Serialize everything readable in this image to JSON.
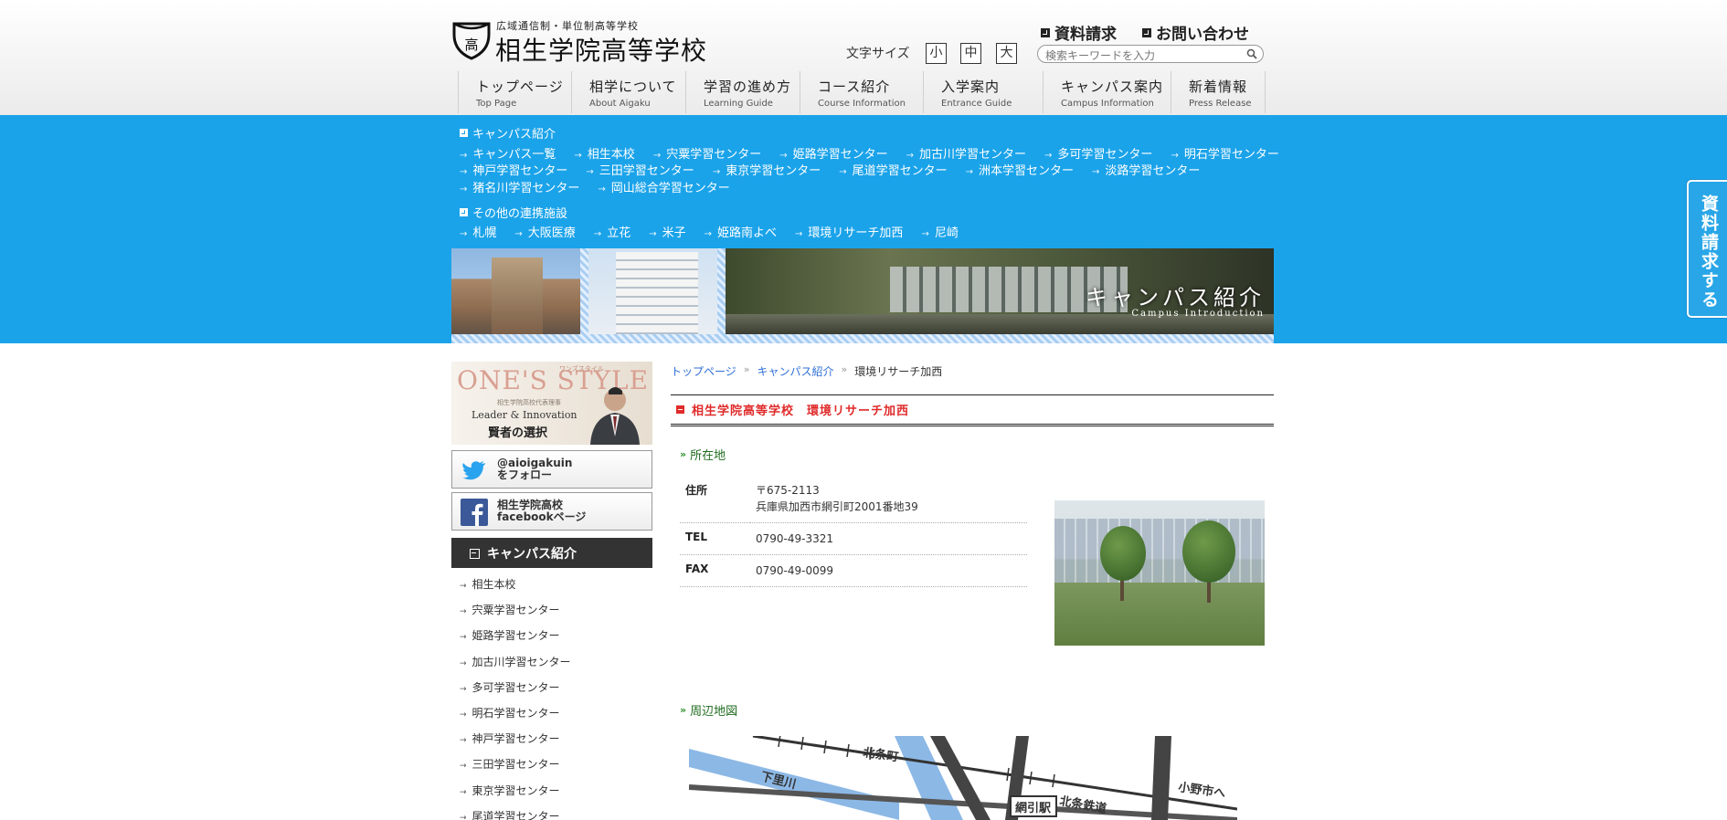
{
  "header": {
    "logo_sub": "広域通信制・単位制高等学校",
    "logo_name": "相生学院高等学校",
    "links": {
      "request": "資料請求",
      "contact": "お問い合わせ"
    },
    "font_size_label": "文字サイズ",
    "font_sizes": [
      "小",
      "中",
      "大"
    ],
    "search_placeholder": "検索キーワードを入力"
  },
  "gnav": [
    {
      "ja": "トップページ",
      "en": "Top Page"
    },
    {
      "ja": "相学について",
      "en": "About Aigaku"
    },
    {
      "ja": "学習の進め方",
      "en": "Learning Guide"
    },
    {
      "ja": "コース紹介",
      "en": "Course Information"
    },
    {
      "ja": "入学案内",
      "en": "Entrance Guide"
    },
    {
      "ja": "キャンパス案内",
      "en": "Campus Information"
    },
    {
      "ja": "新着情報",
      "en": "Press Release"
    }
  ],
  "campus_menu": {
    "title": "キャンパス紹介",
    "row1": [
      "キャンパス一覧",
      "相生本校",
      "宍粟学習センター",
      "姫路学習センター",
      "加古川学習センター",
      "多可学習センター",
      "明石学習センター"
    ],
    "row2": [
      "神戸学習センター",
      "三田学習センター",
      "東京学習センター",
      "尾道学習センター",
      "洲本学習センター",
      "淡路学習センター"
    ],
    "row3": [
      "猪名川学習センター",
      "岡山総合学習センター"
    ]
  },
  "partner_menu": {
    "title": "その他の連携施設",
    "row1": [
      "札幌",
      "大阪医療",
      "立花",
      "米子",
      "姫路南よべ",
      "環境リサーチ加西",
      "尼崎"
    ]
  },
  "banner": {
    "title": "キャンパス紹介",
    "subtitle": "Campus Introduction"
  },
  "side_tab": "資料請求する",
  "sidebar": {
    "ones_style": {
      "title": "ONE'S STYLE",
      "small": "ワンズスタイル",
      "line": "相生学院高校代表理事",
      "tag1": "Leader & Innovation",
      "tag2": "賢者の選択"
    },
    "twitter": {
      "line1": "@aioigakuin",
      "line2": "をフォロー"
    },
    "facebook": {
      "line1": "相生学院高校",
      "line2": "facebookページ"
    },
    "head": "キャンパス紹介",
    "items": [
      "相生本校",
      "宍粟学習センター",
      "姫路学習センター",
      "加古川学習センター",
      "多可学習センター",
      "明石学習センター",
      "神戸学習センター",
      "三田学習センター",
      "東京学習センター",
      "尾道学習センター"
    ]
  },
  "breadcrumb": {
    "home": "トップページ",
    "campus": "キャンパス紹介",
    "current": "環境リサーチ加西"
  },
  "page_title": "相生学院高等学校　環境リサーチ加西",
  "location": {
    "heading": "所在地",
    "address_label": "住所",
    "postal": "〒675-2113",
    "address": "兵庫県加西市網引町2001番地39",
    "tel_label": "TEL",
    "tel": "0790-49-3321",
    "fax_label": "FAX",
    "fax": "0790-49-0099"
  },
  "map": {
    "heading": "周辺地図",
    "labels": {
      "hojo_town": "北条町",
      "shimosato_river": "下里川",
      "ajiki_station": "網引駅",
      "hojo_railway": "北条鉄道",
      "to_ono": "小野市へ"
    }
  }
}
